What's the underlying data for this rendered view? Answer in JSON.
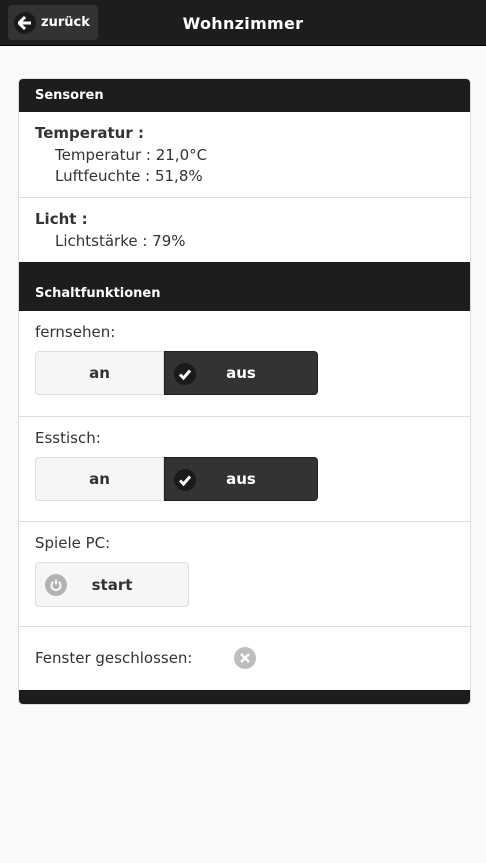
{
  "header": {
    "back_label": "zurück",
    "title": "Wohnzimmer"
  },
  "sensors": {
    "heading": "Sensoren",
    "temperature": {
      "title": "Temperatur :",
      "lines": [
        "Temperatur : 21,0°C",
        "Luftfeuchte : 51,8%"
      ]
    },
    "light": {
      "title": "Licht :",
      "lines": [
        "Lichtstärke : 79%"
      ]
    }
  },
  "switches": {
    "heading": "Schaltfunktionen",
    "items": [
      {
        "label": "fernsehen:",
        "on_label": "an",
        "off_label": "aus",
        "selected": "aus"
      },
      {
        "label": "Esstisch:",
        "on_label": "an",
        "off_label": "aus",
        "selected": "aus"
      }
    ],
    "spiele": {
      "label": "Spiele PC:",
      "button_label": "start"
    },
    "window": {
      "label": "Fenster geschlossen:"
    }
  }
}
